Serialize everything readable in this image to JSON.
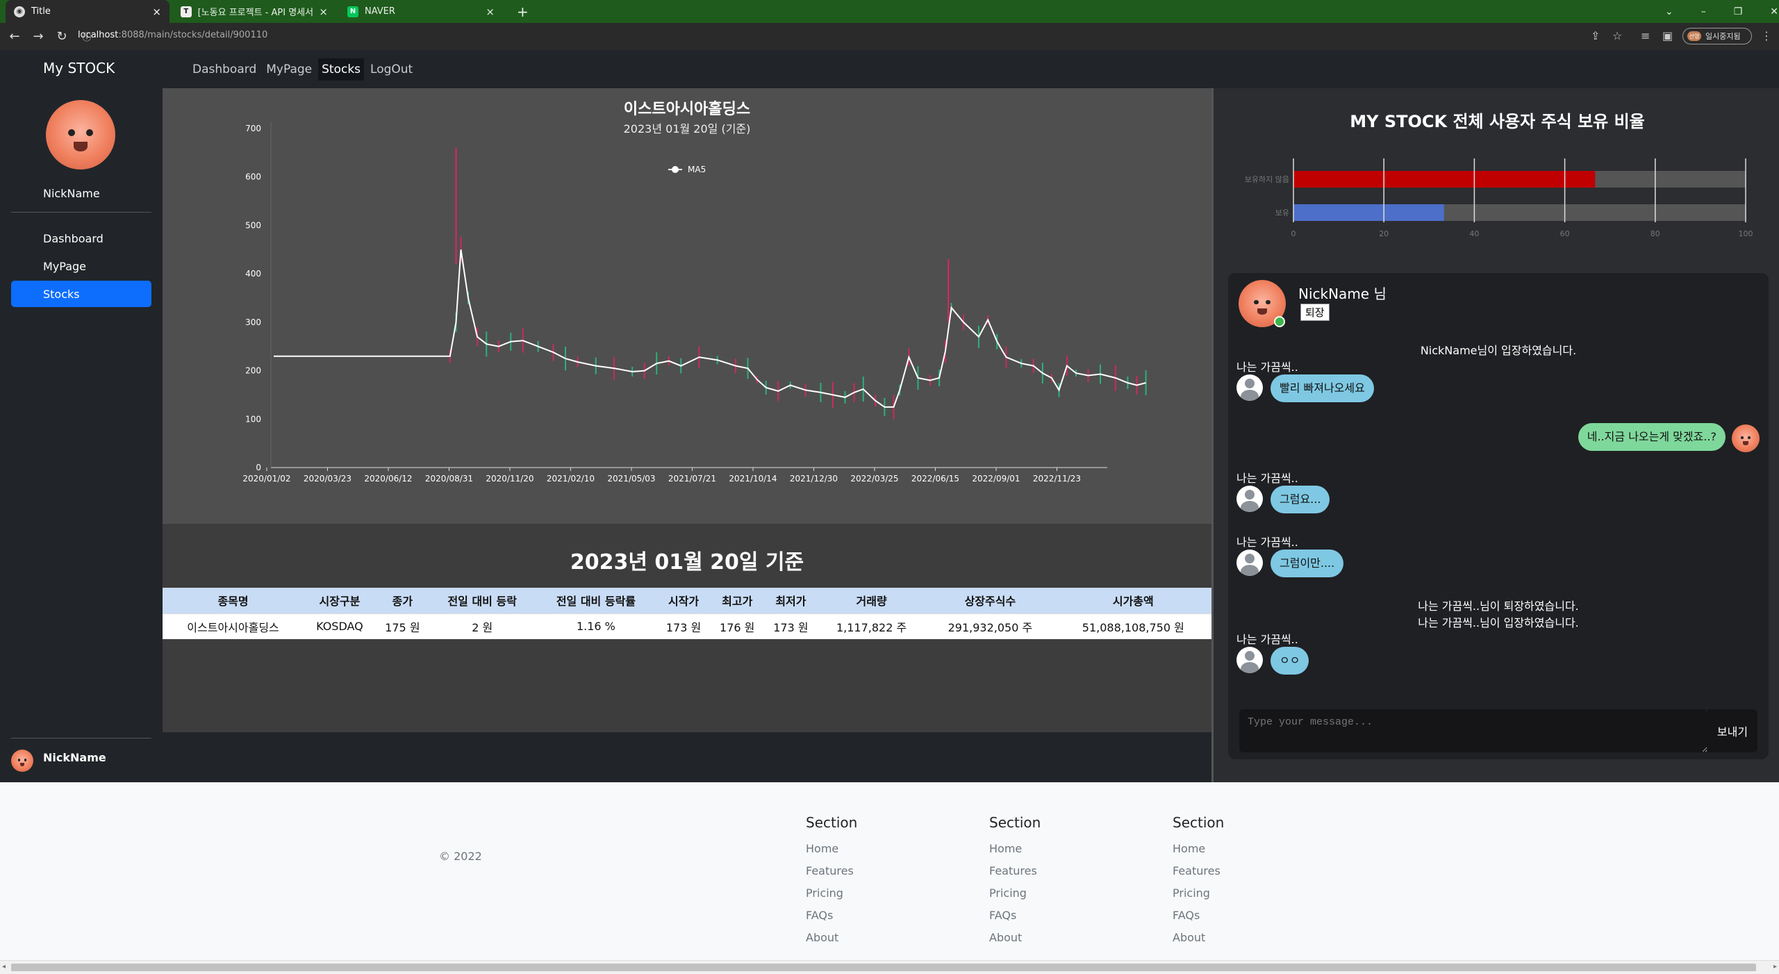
{
  "browser": {
    "tabs": [
      {
        "label": "Title",
        "active": true
      },
      {
        "label": "[노동요 프로젝트 - API 명세서] -",
        "active": false
      },
      {
        "label": "NAVER",
        "active": false
      }
    ],
    "url_host": "localhost",
    "url_path": ":8088/main/stocks/detail/900110",
    "profile_label": "일시중지됨",
    "profile_badge": "선영"
  },
  "sidebar": {
    "brand": "My STOCK",
    "username": "NickName",
    "items": [
      {
        "label": "Dashboard",
        "active": false
      },
      {
        "label": "MyPage",
        "active": false
      },
      {
        "label": "Stocks",
        "active": true
      }
    ],
    "footer_name": "NickName"
  },
  "topnav": {
    "items": [
      {
        "label": "Dashboard",
        "active": false
      },
      {
        "label": "MyPage",
        "active": false
      },
      {
        "label": "Stocks",
        "active": true
      },
      {
        "label": "LogOut",
        "active": false
      }
    ]
  },
  "stock_chart": {
    "title": "이스트아시아홀딩스",
    "subtitle": "2023년 01월 20일 (기준)",
    "legend": "MA5",
    "chart_data": {
      "type": "line",
      "title": "이스트아시아홀딩스",
      "series": [
        {
          "name": "MA5"
        }
      ],
      "x_tick_labels": [
        "2020/01/02",
        "2020/03/23",
        "2020/06/12",
        "2020/08/31",
        "2020/11/20",
        "2021/02/10",
        "2021/05/03",
        "2021/07/21",
        "2021/10/14",
        "2021/12/30",
        "2022/03/25",
        "2022/06/15",
        "2022/09/01",
        "2022/11/23"
      ],
      "y_ticks": [
        0,
        100,
        200,
        300,
        400,
        500,
        600,
        700
      ],
      "ylim": [
        0,
        700
      ],
      "points": [
        [
          0,
          230
        ],
        [
          2.9,
          230
        ],
        [
          3.0,
          300
        ],
        [
          3.08,
          450
        ],
        [
          3.2,
          350
        ],
        [
          3.35,
          270
        ],
        [
          3.5,
          255
        ],
        [
          3.7,
          250
        ],
        [
          3.9,
          260
        ],
        [
          4.1,
          262
        ],
        [
          4.35,
          250
        ],
        [
          4.6,
          238
        ],
        [
          4.8,
          225
        ],
        [
          5.0,
          218
        ],
        [
          5.3,
          210
        ],
        [
          5.6,
          205
        ],
        [
          5.9,
          198
        ],
        [
          6.1,
          200
        ],
        [
          6.3,
          215
        ],
        [
          6.5,
          220
        ],
        [
          6.7,
          210
        ],
        [
          7.0,
          228
        ],
        [
          7.3,
          222
        ],
        [
          7.6,
          210
        ],
        [
          7.8,
          205
        ],
        [
          7.95,
          182
        ],
        [
          8.1,
          165
        ],
        [
          8.3,
          158
        ],
        [
          8.5,
          170
        ],
        [
          8.75,
          160
        ],
        [
          9.0,
          155
        ],
        [
          9.2,
          150
        ],
        [
          9.4,
          145
        ],
        [
          9.55,
          155
        ],
        [
          9.7,
          162
        ],
        [
          9.9,
          138
        ],
        [
          10.05,
          125
        ],
        [
          10.2,
          125
        ],
        [
          10.3,
          160
        ],
        [
          10.45,
          228
        ],
        [
          10.6,
          185
        ],
        [
          10.8,
          180
        ],
        [
          10.95,
          185
        ],
        [
          11.05,
          240
        ],
        [
          11.15,
          330
        ],
        [
          11.35,
          300
        ],
        [
          11.6,
          270
        ],
        [
          11.75,
          305
        ],
        [
          11.9,
          260
        ],
        [
          12.05,
          228
        ],
        [
          12.3,
          215
        ],
        [
          12.5,
          210
        ],
        [
          12.65,
          195
        ],
        [
          12.8,
          185
        ],
        [
          12.92,
          160
        ],
        [
          13.05,
          210
        ],
        [
          13.2,
          195
        ],
        [
          13.4,
          190
        ],
        [
          13.6,
          193
        ],
        [
          13.85,
          185
        ],
        [
          14.05,
          175
        ],
        [
          14.2,
          170
        ],
        [
          14.35,
          175
        ]
      ]
    }
  },
  "date_header": "2023년 01월 20일 기준",
  "stock_table": {
    "headers": [
      "종목명",
      "시장구분",
      "종가",
      "전일 대비 등락",
      "전일 대비 등락률",
      "시작가",
      "최고가",
      "최저가",
      "거래량",
      "상장주식수",
      "시가총액"
    ],
    "row": [
      "이스트아시아홀딩스",
      "KOSDAQ",
      "175 원",
      "2 원",
      "1.16 %",
      "173 원",
      "176 원",
      "173 원",
      "1,117,822 주",
      "291,932,050 주",
      "51,088,108,750 원"
    ]
  },
  "ratio_chart": {
    "title": "MY STOCK 전체 사용자 주식 보유 비율",
    "chart_data": {
      "type": "bar",
      "orientation": "horizontal",
      "categories": [
        "보유하지 않음",
        "보유"
      ],
      "values": [
        66.7,
        33.3
      ],
      "colors": [
        "#c00000",
        "#4d6fc9"
      ],
      "xlim": [
        0,
        100
      ],
      "x_ticks": [
        0,
        20,
        40,
        60,
        80,
        100
      ]
    }
  },
  "chat": {
    "header_user": "NickName 님",
    "leave_label": "퇴장",
    "messages": [
      {
        "type": "system",
        "text": "NickName님이 입장하였습니다."
      },
      {
        "type": "other",
        "sender": "나는 가끔씩..",
        "text": "빨리 빠져나오세요"
      },
      {
        "type": "mine",
        "text": "네..지금 나오는게 맞겠죠..?"
      },
      {
        "type": "other",
        "sender": "나는 가끔씩..",
        "text": "그럼요..."
      },
      {
        "type": "other",
        "sender": "나는 가끔씩..",
        "text": "그럼이만...."
      },
      {
        "type": "system",
        "text": "나는 가끔씩..님이 퇴장하였습니다."
      },
      {
        "type": "system",
        "text": "나는 가끔씩..님이 입장하였습니다."
      },
      {
        "type": "other",
        "sender": "나는 가끔씩..",
        "text": "ㅇㅇ"
      }
    ],
    "input_placeholder": "Type your message...",
    "send_label": "보내기"
  },
  "footer": {
    "copyright": "© 2022",
    "sections": [
      {
        "title": "Section",
        "links": [
          "Home",
          "Features",
          "Pricing",
          "FAQs",
          "About"
        ]
      },
      {
        "title": "Section",
        "links": [
          "Home",
          "Features",
          "Pricing",
          "FAQs",
          "About"
        ]
      },
      {
        "title": "Section",
        "links": [
          "Home",
          "Features",
          "Pricing",
          "FAQs",
          "About"
        ]
      }
    ]
  }
}
